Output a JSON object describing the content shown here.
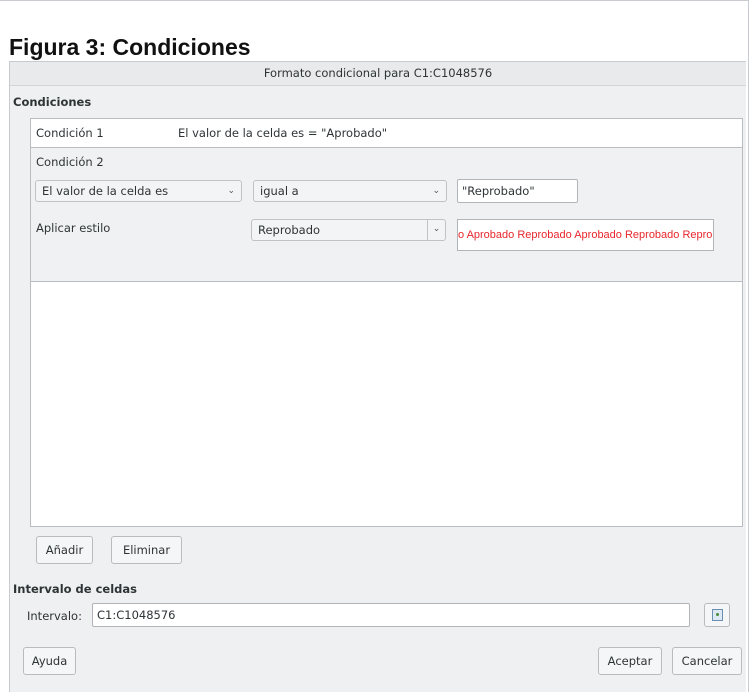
{
  "figure": {
    "title": "Figura 3: Condiciones"
  },
  "dialog": {
    "title": "Formato condicional para C1:C1048576",
    "conditions_label": "Condiciones",
    "condition1": {
      "label": "Condición 1",
      "summary": "El valor de la celda es = \"Aprobado\""
    },
    "condition2": {
      "label": "Condición 2",
      "type_value": "El valor de la celda es",
      "operator_value": "igual a",
      "value_input": "\"Reprobado\"",
      "apply_style_label": "Aplicar estilo",
      "style_value": "Reprobado",
      "preview_text": "o Aprobado Reprobado Aprobado Reprobado Reprobado Reprot"
    },
    "buttons": {
      "add": "Añadir",
      "delete": "Eliminar",
      "help": "Ayuda",
      "accept": "Aceptar",
      "cancel": "Cancelar"
    },
    "range": {
      "section_label": "Intervalo de celdas",
      "field_label": "Intervalo:",
      "value": "C1:C1048576"
    }
  },
  "colors": {
    "preview_text": "#e8262b",
    "dialog_bg": "#eef0f2"
  },
  "icons": {
    "combo_arrow": "chevron-down-icon",
    "range_shrink": "shrink-range-icon"
  }
}
